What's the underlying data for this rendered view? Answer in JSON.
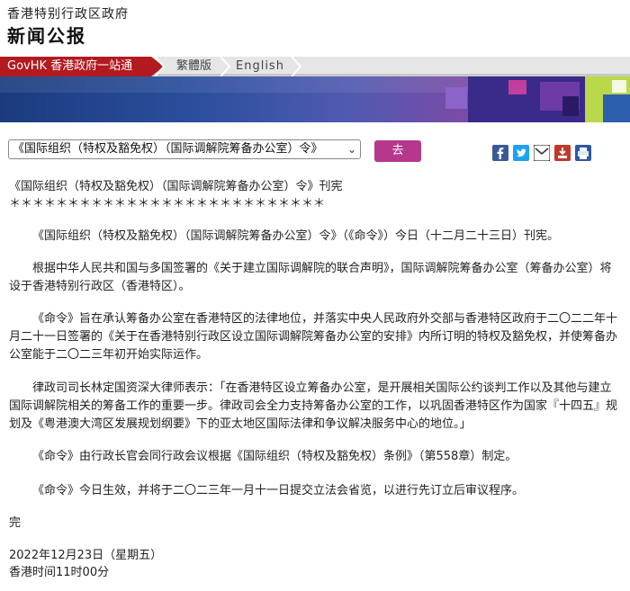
{
  "header": {
    "gov_name": "香港特别行政区政府",
    "site_title": "新闻公报"
  },
  "tabs": {
    "govhk": "GovHK 香港政府一站通",
    "traditional": "繁體版",
    "english": "English"
  },
  "selector": {
    "selected": "《国际组织（特权及豁免权）（国际调解院筹备办公室）令》",
    "go_label": "去"
  },
  "share_icons": [
    "facebook-icon",
    "twitter-icon",
    "email-icon",
    "download-icon",
    "print-icon"
  ],
  "colors": {
    "govhk_tab": "#b31a1f",
    "go_button": "#b5388c",
    "facebook": "#3b5998",
    "twitter": "#1da1f2"
  },
  "article": {
    "headline": "《国际组织（特权及豁免权）（国际调解院筹备办公室）令》刊宪",
    "divider": "＊＊＊＊＊＊＊＊＊＊＊＊＊＊＊＊＊＊＊＊＊＊＊＊＊＊＊",
    "paragraphs": [
      "《国际组织（特权及豁免权）（国际调解院筹备办公室）令》（《命令》）今日（十二月二十三日）刊宪。",
      "根据中华人民共和国与多国签署的《关于建立国际调解院的联合声明》，国际调解院筹备办公室（筹备办公室）将设于香港特别行政区（香港特区）。",
      "《命令》旨在承认筹备办公室在香港特区的法律地位，并落实中央人民政府外交部与香港特区政府于二〇二二年十月二十一日签署的《关于在香港特别行政区设立国际调解院筹备办公室的安排》内所订明的特权及豁免权，并使筹备办公室能于二〇二三年初开始实际运作。",
      "律政司司长林定国资深大律师表示：「在香港特区设立筹备办公室，是开展相关国际公约谈判工作以及其他与建立国际调解院相关的筹备工作的重要一步。律政司会全力支持筹备办公室的工作，以巩固香港特区作为国家『十四五』规划及《粤港澳大湾区发展规划纲要》下的亚太地区国际法律和争议解决服务中心的地位。」",
      "《命令》由行政长官会同行政会议根据《国际组织（特权及豁免权）条例》（第558章）制定。",
      "《命令》今日生效，并将于二〇二三年一月十一日提交立法会省览，以进行先订立后审议程序。"
    ],
    "end": "完",
    "date": "2022年12月23日（星期五）",
    "time": "香港时间11时00分"
  }
}
